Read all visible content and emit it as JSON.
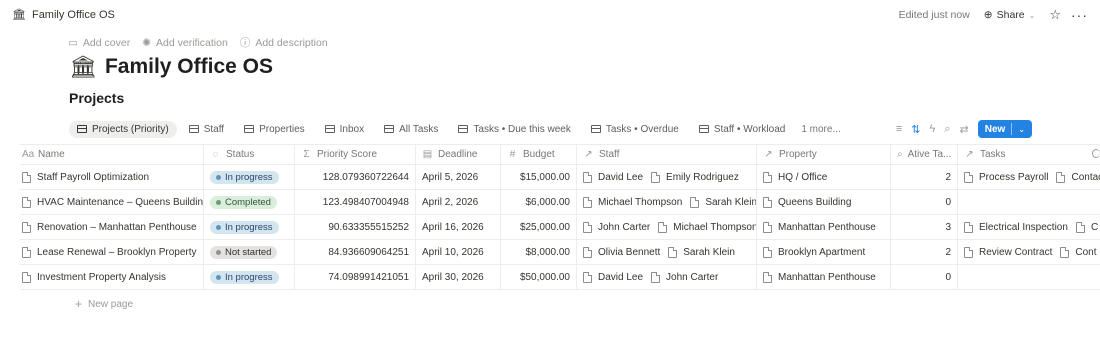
{
  "topbar": {
    "breadcrumb_icon": "bank-icon",
    "breadcrumb": "Family Office OS",
    "edited": "Edited just now",
    "share_label": "Share"
  },
  "page": {
    "actions": {
      "add_cover": "Add cover",
      "add_verification": "Add verification",
      "add_description": "Add description"
    },
    "emoji": "🏛",
    "title": "Family Office OS",
    "database_title": "Projects"
  },
  "views": {
    "tabs": [
      {
        "label": "Projects (Priority)",
        "active": true
      },
      {
        "label": "Staff",
        "active": false
      },
      {
        "label": "Properties",
        "active": false
      },
      {
        "label": "Inbox",
        "active": false
      },
      {
        "label": "All Tasks",
        "active": false
      },
      {
        "label": "Tasks • Due this week",
        "active": false
      },
      {
        "label": "Tasks • Overdue",
        "active": false
      },
      {
        "label": "Staff • Workload",
        "active": false
      }
    ],
    "more": "1 more...",
    "new_label": "New"
  },
  "table": {
    "columns": {
      "name": "Name",
      "status": "Status",
      "score": "Priority Score",
      "deadline": "Deadline",
      "budget": "Budget",
      "staff": "Staff",
      "property": "Property",
      "ative": "Ative Ta...",
      "tasks": "Tasks"
    },
    "rows": [
      {
        "name": "Staff Payroll Optimization",
        "status": "In progress",
        "score": "128.079360722644",
        "deadline": "April 5, 2026",
        "budget": "$15,000.00",
        "staff": [
          "David Lee",
          "Emily Rodriguez"
        ],
        "property": "HQ / Office",
        "ative": "2",
        "tasks": [
          "Process Payroll",
          "Contac"
        ]
      },
      {
        "name": "HVAC Maintenance – Queens Building",
        "status": "Completed",
        "score": "123.498407004948",
        "deadline": "April 2, 2026",
        "budget": "$6,000.00",
        "staff": [
          "Michael Thompson",
          "Sarah Klein"
        ],
        "property": "Queens Building",
        "ative": "0",
        "tasks": []
      },
      {
        "name": "Renovation – Manhattan Penthouse",
        "status": "In progress",
        "score": "90.633355515252",
        "deadline": "April 16, 2026",
        "budget": "$25,000.00",
        "staff": [
          "John Carter",
          "Michael Thompson"
        ],
        "property": "Manhattan Penthouse",
        "ative": "3",
        "tasks": [
          "Electrical Inspection",
          "C"
        ]
      },
      {
        "name": "Lease Renewal – Brooklyn Property",
        "status": "Not started",
        "score": "84.936609064251",
        "deadline": "April 10, 2026",
        "budget": "$8,000.00",
        "staff": [
          "Olivia Bennett",
          "Sarah Klein"
        ],
        "property": "Brooklyn Apartment",
        "ative": "2",
        "tasks": [
          "Review Contract",
          "Cont"
        ]
      },
      {
        "name": "Investment Property Analysis",
        "status": "In progress",
        "score": "74.098991421051",
        "deadline": "April 30, 2026",
        "budget": "$50,000.00",
        "staff": [
          "David Lee",
          "John Carter"
        ],
        "property": "Manhattan Penthouse",
        "ative": "0",
        "tasks": []
      }
    ],
    "new_page": "New page"
  },
  "status_styles": {
    "In progress": {
      "bg": "#d3e5ef",
      "fg": "#28456c",
      "dot": "#5b97bd"
    },
    "Completed": {
      "bg": "#dbeddb",
      "fg": "#2b593f",
      "dot": "#6c9b7d"
    },
    "Not started": {
      "bg": "#e3e2e0",
      "fg": "#32302c",
      "dot": "#91918e"
    }
  },
  "colors": {
    "accent": "#2383e2",
    "text": "#37352f",
    "muted": "#9b9a97"
  }
}
